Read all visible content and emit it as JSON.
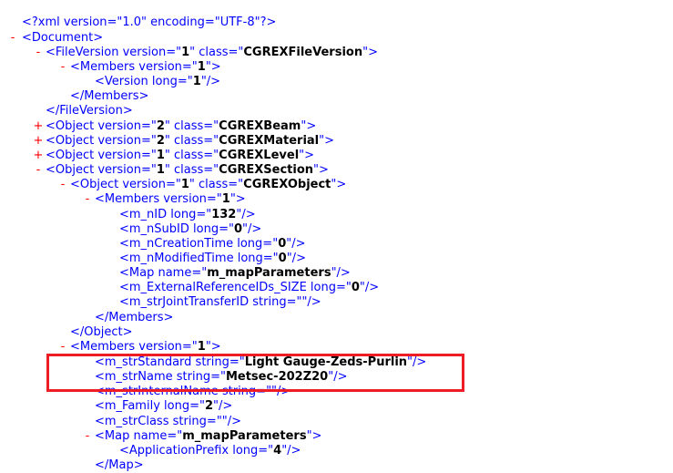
{
  "accent_color": "#ee1c25",
  "tag_color": "#0000ff",
  "toggle_color": "#ff0000",
  "lines": [
    {
      "toggle": "",
      "pre": "<?xml version=\"1.0\" encoding=\"UTF-8\"?>",
      "val": "",
      "post": ""
    },
    {
      "toggle": "-",
      "pre": "<Document>",
      "val": "",
      "post": ""
    },
    {
      "toggle": "-",
      "pre": "<FileVersion version=\"",
      "val": "1",
      "post": "\" class=\"",
      "val2": "CGREXFileVersion",
      "post2": "\">"
    },
    {
      "toggle": "-",
      "pre": "<Members version=\"",
      "val": "1",
      "post": "\">"
    },
    {
      "toggle": "",
      "pre": "<Version long=\"",
      "val": "1",
      "post": "\"/>"
    },
    {
      "toggle": "",
      "pre": "</Members>",
      "val": "",
      "post": ""
    },
    {
      "toggle": "",
      "pre": "</FileVersion>",
      "val": "",
      "post": ""
    },
    {
      "toggle": "+",
      "pre": "<Object version=\"",
      "val": "2",
      "post": "\" class=\"",
      "val2": "CGREXBeam",
      "post2": "\">"
    },
    {
      "toggle": "+",
      "pre": "<Object version=\"",
      "val": "2",
      "post": "\" class=\"",
      "val2": "CGREXMaterial",
      "post2": "\">"
    },
    {
      "toggle": "+",
      "pre": "<Object version=\"",
      "val": "1",
      "post": "\" class=\"",
      "val2": "CGREXLevel",
      "post2": "\">"
    },
    {
      "toggle": "-",
      "pre": "<Object version=\"",
      "val": "1",
      "post": "\" class=\"",
      "val2": "CGREXSection",
      "post2": "\">"
    },
    {
      "toggle": "-",
      "pre": "<Object version=\"",
      "val": "1",
      "post": "\" class=\"",
      "val2": "CGREXObject",
      "post2": "\">"
    },
    {
      "toggle": "-",
      "pre": "<Members version=\"",
      "val": "1",
      "post": "\">"
    },
    {
      "toggle": "",
      "pre": "<m_nID long=\"",
      "val": "132",
      "post": "\"/>"
    },
    {
      "toggle": "",
      "pre": "<m_nSubID long=\"",
      "val": "0",
      "post": "\"/>"
    },
    {
      "toggle": "",
      "pre": "<m_nCreationTime long=\"",
      "val": "0",
      "post": "\"/>"
    },
    {
      "toggle": "",
      "pre": "<m_nModifiedTime long=\"",
      "val": "0",
      "post": "\"/>"
    },
    {
      "toggle": "",
      "pre": "<Map name=\"",
      "val": "m_mapParameters",
      "post": "\"/>"
    },
    {
      "toggle": "",
      "pre": "<m_ExternalReferenceIDs_SIZE long=\"",
      "val": "0",
      "post": "\"/>"
    },
    {
      "toggle": "",
      "pre": "<m_strJointTransferID string=\"\"/>",
      "val": "",
      "post": ""
    },
    {
      "toggle": "",
      "pre": "</Members>",
      "val": "",
      "post": ""
    },
    {
      "toggle": "",
      "pre": "</Object>",
      "val": "",
      "post": ""
    },
    {
      "toggle": "-",
      "pre": "<Members version=\"",
      "val": "1",
      "post": "\">"
    },
    {
      "toggle": "",
      "pre": "<m_strStandard string=\"",
      "val": "Light Gauge-Zeds-Purlin",
      "post": "\"/>"
    },
    {
      "toggle": "",
      "pre": "<m_strName string=\"",
      "val": "Metsec-202Z20",
      "post": "\"/>"
    },
    {
      "toggle": "",
      "pre": "<m_strInternalName string=\"\"/>",
      "val": "",
      "post": ""
    },
    {
      "toggle": "",
      "pre": "<m_Family long=\"",
      "val": "2",
      "post": "\"/>"
    },
    {
      "toggle": "",
      "pre": "<m_strClass string=\"\"/>",
      "val": "",
      "post": ""
    },
    {
      "toggle": "-",
      "pre": "<Map name=\"",
      "val": "m_mapParameters",
      "post": "\">"
    },
    {
      "toggle": "",
      "pre": "<ApplicationPrefix long=\"",
      "val": "4",
      "post": "\"/>"
    },
    {
      "toggle": "",
      "pre": "</Map>",
      "val": "",
      "post": ""
    }
  ]
}
